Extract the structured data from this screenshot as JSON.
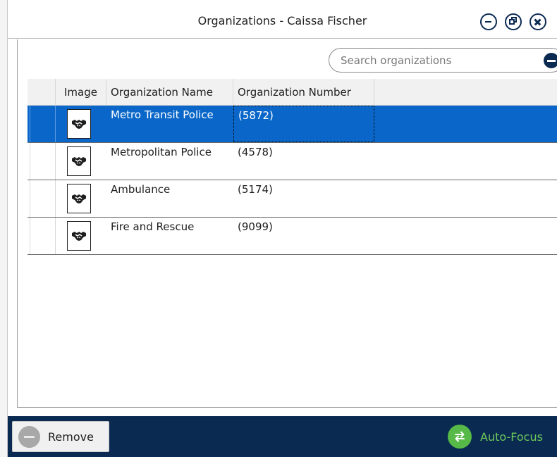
{
  "window": {
    "title": "Organizations - Caissa Fischer",
    "controls": {
      "minimize_icon": "minimize-circle-icon",
      "restore_icon": "restore-circle-icon",
      "close_icon": "close-circle-icon"
    }
  },
  "search": {
    "placeholder": "Search organizations",
    "value": "",
    "button_icon": "minus-circle-icon"
  },
  "grid": {
    "columns": {
      "image": "Image",
      "name": "Organization Name",
      "number": "Organization Number"
    },
    "rows": [
      {
        "name": "Metro Transit Police",
        "number": "(5872)",
        "icon": "handshake-icon",
        "selected": true
      },
      {
        "name": "Metropolitan Police",
        "number": "(4578)",
        "icon": "handshake-icon",
        "selected": false
      },
      {
        "name": "Ambulance",
        "number": "(5174)",
        "icon": "handshake-icon",
        "selected": false
      },
      {
        "name": "Fire and Rescue",
        "number": "(9099)",
        "icon": "handshake-icon",
        "selected": false
      }
    ]
  },
  "bottom_bar": {
    "remove_label": "Remove",
    "remove_icon": "minus-circle-icon",
    "autofocus_label": "Auto-Focus",
    "autofocus_icon": "swap-arrows-icon"
  },
  "colors": {
    "primary_dark": "#0b2a52",
    "selection": "#0a67c9",
    "accent_green": "#57b947"
  }
}
